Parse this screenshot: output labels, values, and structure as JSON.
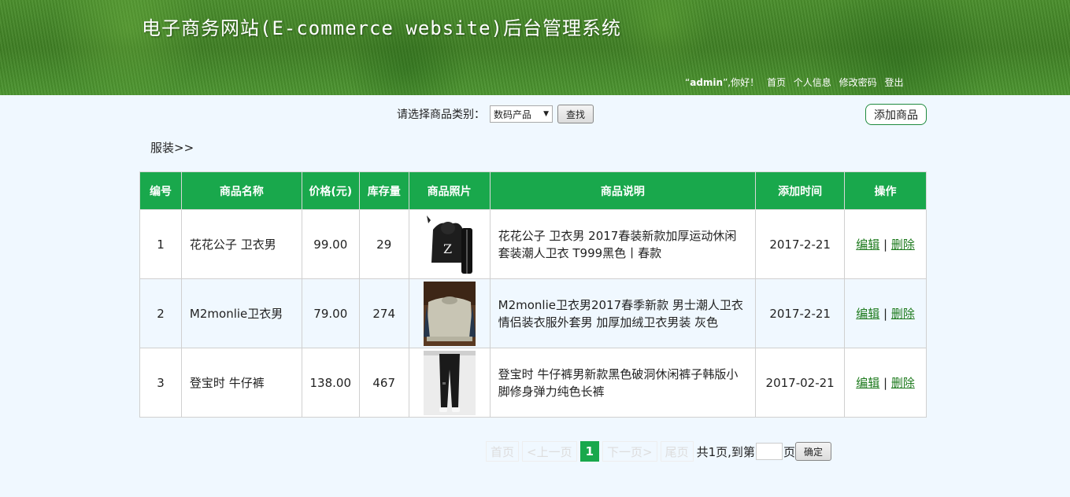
{
  "header": {
    "title": "电子商务网站(E-commerce website)后台管理系统",
    "user_name": "admin",
    "greeting": ",你好！",
    "nav": [
      "首页",
      "个人信息",
      "修改密码",
      "登出"
    ]
  },
  "filter": {
    "label": "请选择商品类别：",
    "selected": "数码产品",
    "search_label": "查找"
  },
  "add_product_label": "添加商品",
  "breadcrumb": "服装>>",
  "table": {
    "headers": [
      "编号",
      "商品名称",
      "价格(元)",
      "库存量",
      "商品照片",
      "商品说明",
      "添加时间",
      "操作"
    ],
    "rows": [
      {
        "id": "1",
        "name": "花花公子 卫衣男",
        "price": "99.00",
        "stock": "29",
        "desc": "花花公子 卫衣男 2017春装新款加厚运动休闲套装潮人卫衣 T999黑色丨春款",
        "date": "2017-2-21",
        "edit": "编辑",
        "delete": "删除"
      },
      {
        "id": "2",
        "name": "M2monlie卫衣男",
        "price": "79.00",
        "stock": "274",
        "desc": "M2monlie卫衣男2017春季新款 男士潮人卫衣情侣装衣服外套男 加厚加绒卫衣男装 灰色",
        "date": "2017-2-21",
        "edit": "编辑",
        "delete": "删除"
      },
      {
        "id": "3",
        "name": "登宝时 牛仔裤",
        "price": "138.00",
        "stock": "467",
        "desc": "登宝时 牛仔裤男新款黑色破洞休闲裤子韩版小脚修身弹力纯色长裤",
        "date": "2017-02-21",
        "edit": "编辑",
        "delete": "删除"
      }
    ]
  },
  "pager": {
    "first": "首页",
    "prev": "<上一页",
    "current": "1",
    "next": "下一页>",
    "last": "尾页",
    "total": "共1页,到第",
    "page_suffix": "页",
    "confirm": "确定"
  },
  "colors": {
    "accent": "#19a84c",
    "header_green": "#4a8e2c",
    "link": "#1d7a1d",
    "background": "#f0f8ff"
  }
}
